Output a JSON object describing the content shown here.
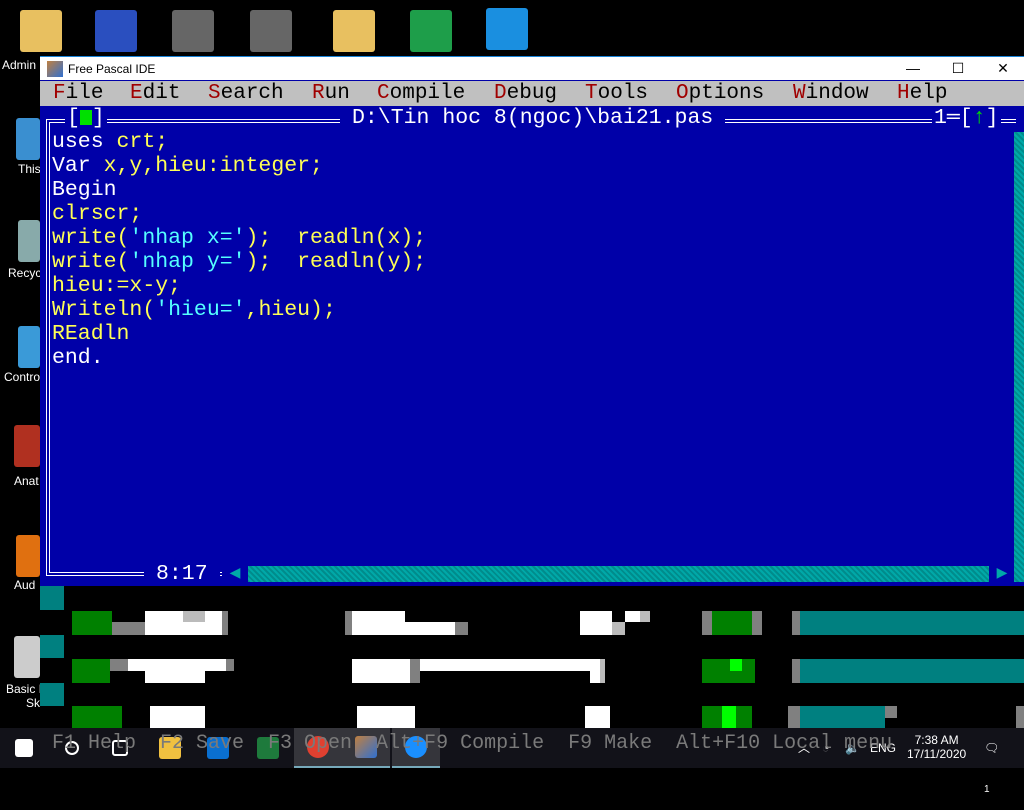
{
  "desktop": {
    "icons": [
      {
        "label": "Admin",
        "icon": "user-folder-icon"
      },
      {
        "label": "This",
        "icon": "this-pc-icon"
      },
      {
        "label": "Recyc",
        "icon": "recycle-bin-icon"
      },
      {
        "label": "Contro",
        "icon": "control-panel-icon"
      },
      {
        "label": "Anat",
        "icon": "anatomy-app-icon"
      },
      {
        "label": "Aud",
        "icon": "audio-app-icon"
      },
      {
        "label": "Basic I",
        "icon": "basic-app-icon"
      },
      {
        "label": "Sk",
        "icon": ""
      }
    ]
  },
  "window": {
    "title": "Free Pascal IDE",
    "minimize": "—",
    "maximize": "☐",
    "close": "✕"
  },
  "menu": [
    {
      "hk": "F",
      "rest": "ile"
    },
    {
      "hk": "E",
      "rest": "dit"
    },
    {
      "hk": "S",
      "rest": "earch"
    },
    {
      "hk": "R",
      "rest": "un"
    },
    {
      "hk": "C",
      "rest": "ompile"
    },
    {
      "hk": "D",
      "rest": "ebug"
    },
    {
      "hk": "T",
      "rest": "ools"
    },
    {
      "hk": "O",
      "rest": "ptions"
    },
    {
      "hk": "W",
      "rest": "indow"
    },
    {
      "hk": "H",
      "rest": "elp"
    }
  ],
  "editor": {
    "file_path": "D:\\Tin hoc 8(ngoc)\\bai21.pas",
    "window_number": "1",
    "cursor_pos": "8:17",
    "lines": [
      [
        [
          "kw",
          "uses "
        ],
        [
          "id",
          "crt;"
        ]
      ],
      [
        [
          "kw",
          "Var "
        ],
        [
          "id",
          "x,y,hieu:integer;"
        ]
      ],
      [
        [
          "kw",
          "Begin"
        ]
      ],
      [
        [
          "id",
          "clrscr;"
        ]
      ],
      [
        [
          "id",
          "write("
        ],
        [
          "str",
          "'nhap x='"
        ],
        [
          "id",
          ");  readln(x);"
        ]
      ],
      [
        [
          "id",
          "write("
        ],
        [
          "str",
          "'nhap y='"
        ],
        [
          "id",
          ");  readln(y);"
        ]
      ],
      [
        [
          "id",
          "hieu:=x-y;"
        ]
      ],
      [
        [
          "id",
          "Writeln("
        ],
        [
          "str",
          "'hieu='"
        ],
        [
          "id",
          ",hieu);"
        ]
      ],
      [
        [
          "id",
          "REadln"
        ]
      ],
      [
        [
          "kw",
          "end."
        ]
      ]
    ]
  },
  "statusline": "F1 Help  F2 Save  F3 Open  Alt+F9 Compile  F9 Make  Alt+F10 Local menu",
  "taskbar": {
    "time": "7:38 AM",
    "date": "17/11/2020",
    "lang": "ENG",
    "notifications": "1"
  }
}
